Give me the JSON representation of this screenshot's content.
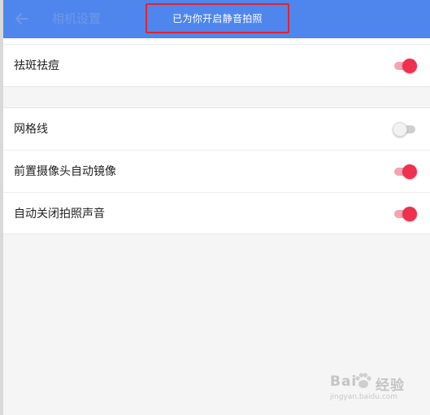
{
  "appbar": {
    "title": "相机设置",
    "back_icon": "arrow-left-icon"
  },
  "toast": {
    "message": "已为你开启静音拍照",
    "highlight_color": "#e3242b"
  },
  "settings": [
    {
      "label": "祛斑祛痘",
      "enabled": true
    },
    {
      "label": "网格线",
      "enabled": false
    },
    {
      "label": "前置摄像头自动镜像",
      "enabled": true
    },
    {
      "label": "自动关闭拍照声音",
      "enabled": true
    }
  ],
  "colors": {
    "appbar": "#4f86ee",
    "switch_on": "#f0304f",
    "switch_on_track": "#f5a3b2",
    "switch_off_track": "#cfcfcf",
    "background": "#f5f5f5"
  },
  "watermark": {
    "brand": "Bai",
    "brand_suffix": "经验",
    "url": "jingyan.baidu.com"
  }
}
